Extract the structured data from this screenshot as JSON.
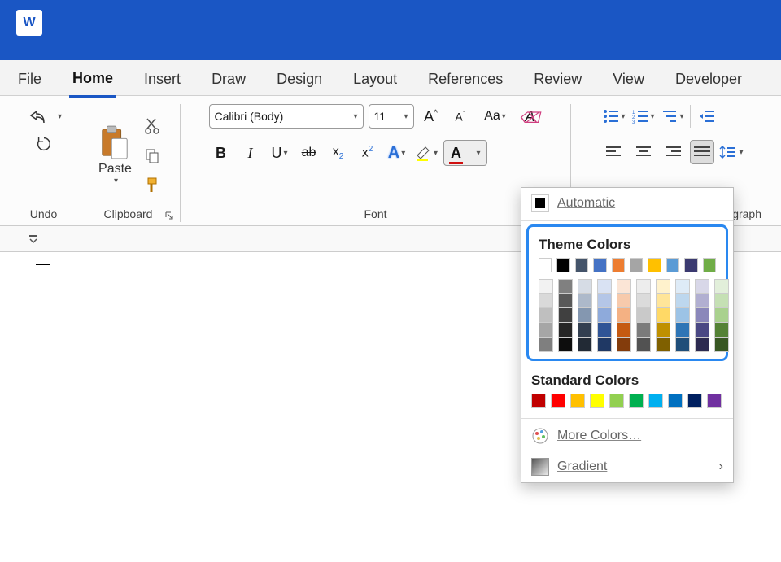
{
  "app": {
    "logo_letter": "W"
  },
  "tabs": {
    "file": "File",
    "home": "Home",
    "insert": "Insert",
    "draw": "Draw",
    "design": "Design",
    "layout": "Layout",
    "references": "References",
    "review": "Review",
    "view": "View",
    "developer": "Developer",
    "active": "home"
  },
  "groups": {
    "undo": "Undo",
    "clipboard": "Clipboard",
    "font": "Font",
    "paragraph": "graph"
  },
  "clipboard": {
    "paste_label": "Paste"
  },
  "font": {
    "name": "Calibri (Body)",
    "size": "11"
  },
  "color_panel": {
    "automatic": "Automatic",
    "theme_header": "Theme Colors",
    "standard_header": "Standard Colors",
    "more": "More Colors…",
    "gradient": "Gradient",
    "theme_main": [
      "#ffffff",
      "#000000",
      "#44546a",
      "#4472c4",
      "#ed7d31",
      "#a5a5a5",
      "#ffc000",
      "#5b9bd5",
      "#3b3a70",
      "#70ad47"
    ],
    "theme_shades": [
      [
        "#f2f2f2",
        "#d9d9d9",
        "#bfbfbf",
        "#a6a6a6",
        "#7f7f7f"
      ],
      [
        "#808080",
        "#595959",
        "#404040",
        "#262626",
        "#0d0d0d"
      ],
      [
        "#d6dce5",
        "#adb9ca",
        "#8497b0",
        "#333f50",
        "#222a35"
      ],
      [
        "#d9e2f3",
        "#b4c6e7",
        "#8eaadb",
        "#2f5496",
        "#1f3864"
      ],
      [
        "#fbe5d6",
        "#f7caac",
        "#f4b183",
        "#c55a11",
        "#833c0c"
      ],
      [
        "#ededed",
        "#dbdbdb",
        "#c9c9c9",
        "#7b7b7b",
        "#525252"
      ],
      [
        "#fff2cc",
        "#ffe599",
        "#ffd966",
        "#bf9000",
        "#7f6000"
      ],
      [
        "#deebf7",
        "#bdd7ee",
        "#9cc3e6",
        "#2e75b6",
        "#1f4e79"
      ],
      [
        "#d8d7e8",
        "#b1afd1",
        "#8a87ba",
        "#4a4884",
        "#2c2a50"
      ],
      [
        "#e2efda",
        "#c5e0b4",
        "#a9d18e",
        "#548235",
        "#385723"
      ]
    ],
    "standard": [
      "#c00000",
      "#ff0000",
      "#ffc000",
      "#ffff00",
      "#92d050",
      "#00b050",
      "#00b0f0",
      "#0070c0",
      "#002060",
      "#7030a0"
    ]
  }
}
